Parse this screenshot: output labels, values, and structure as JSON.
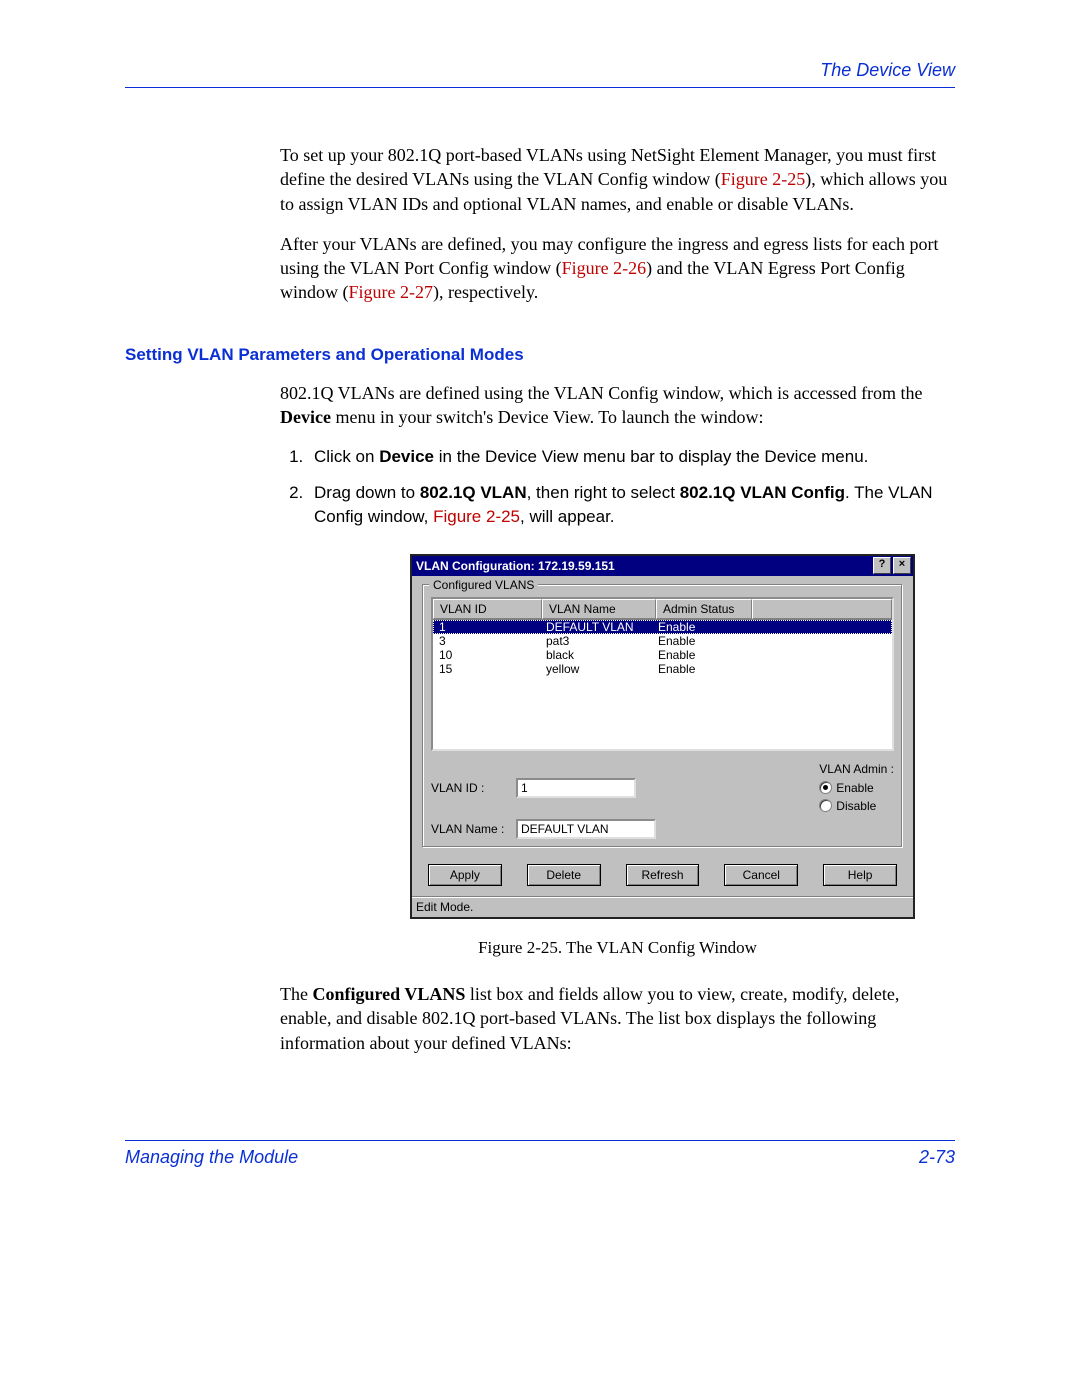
{
  "header": {
    "section": "The Device View"
  },
  "para1": {
    "t1": "To set up your 802.1Q port-based VLANs using NetSight Element Manager, you must first define the desired VLANs using the VLAN Config window (",
    "ref": "Figure 2-25",
    "t2": "), which allows you to assign VLAN IDs and optional VLAN names, and enable or disable VLANs."
  },
  "para2": {
    "t1": "After your VLANs are defined, you may configure the ingress and egress lists for each port using the VLAN Port Config window (",
    "ref1": "Figure 2-26",
    "t2": ") and the VLAN Egress Port Config window (",
    "ref2": "Figure 2-27",
    "t3": "), respectively."
  },
  "section_title": "Setting VLAN Parameters and Operational Modes",
  "para3": {
    "t1": "802.1Q VLANs are defined using the VLAN Config window, which is accessed from the ",
    "b1": "Device",
    "t2": " menu in your switch's Device View. To launch the window:"
  },
  "steps": [
    {
      "pre": "Click on ",
      "b": "Device",
      "post": " in the Device View menu bar to display the Device menu."
    },
    {
      "pre": "Drag down to ",
      "b": "802.1Q VLAN",
      "mid": ", then right to select ",
      "b2": "802.1Q VLAN Config",
      "post": ". The VLAN Config window, ",
      "ref": "Figure 2-25",
      "post2": ", will appear."
    }
  ],
  "dialog": {
    "title": "VLAN Configuration: 172.19.59.151",
    "help_btn": "?",
    "close_btn": "×",
    "group_label": "Configured VLANS",
    "columns": [
      "VLAN ID",
      "VLAN Name",
      "Admin Status"
    ],
    "rows": [
      {
        "id": "1",
        "name": "DEFAULT VLAN",
        "status": "Enable",
        "selected": true
      },
      {
        "id": "3",
        "name": "pat3",
        "status": "Enable",
        "selected": false
      },
      {
        "id": "10",
        "name": "black",
        "status": "Enable",
        "selected": false
      },
      {
        "id": "15",
        "name": "yellow",
        "status": "Enable",
        "selected": false
      }
    ],
    "vlan_id_label": "VLAN ID :",
    "vlan_id_value": "1",
    "vlan_name_label": "VLAN Name :",
    "vlan_name_value": "DEFAULT VLAN",
    "admin_label": "VLAN Admin :",
    "enable_label": "Enable",
    "disable_label": "Disable",
    "buttons": {
      "apply": "Apply",
      "delete": "Delete",
      "refresh": "Refresh",
      "cancel": "Cancel",
      "help": "Help"
    },
    "status_text": "Edit Mode."
  },
  "caption": "Figure 2-25. The VLAN Config Window",
  "para4": {
    "t1": "The ",
    "b1": "Configured VLANS",
    "t2": " list box and fields allow you to view, create, modify, delete, enable, and disable 802.1Q port-based VLANs. The list box displays the following information about your defined VLANs:"
  },
  "footer": {
    "left": "Managing the Module",
    "right": "2-73"
  }
}
